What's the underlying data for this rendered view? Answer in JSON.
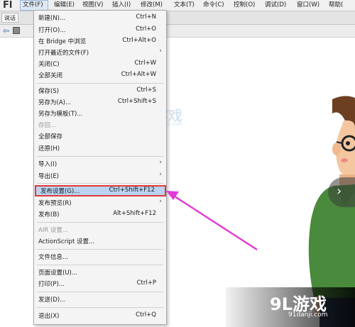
{
  "app": {
    "logo": "Fl"
  },
  "menubar": {
    "items": [
      "文件(F)",
      "编辑(E)",
      "视图(V)",
      "插入(I)",
      "修改(M)",
      "文本(T)",
      "命令(C)",
      "控制(O)",
      "调试(D)",
      "窗口(W)",
      "帮助("
    ]
  },
  "tabbar": {
    "doc_tab": "说话"
  },
  "file_menu": {
    "items": [
      {
        "label": "新建(N)...",
        "shortcut": "Ctrl+N"
      },
      {
        "label": "打开(O)...",
        "shortcut": "Ctrl+O"
      },
      {
        "label": "在 Bridge 中浏览",
        "shortcut": "Ctrl+Alt+O"
      },
      {
        "label": "打开最近的文件(F)",
        "shortcut": ""
      },
      {
        "label": "关闭(C)",
        "shortcut": "Ctrl+W"
      },
      {
        "label": "全部关闭",
        "shortcut": "Ctrl+Alt+W"
      },
      {
        "label": "保存(S)",
        "shortcut": "Ctrl+S"
      },
      {
        "label": "另存为(A)...",
        "shortcut": "Ctrl+Shift+S"
      },
      {
        "label": "另存为模板(T)...",
        "shortcut": ""
      },
      {
        "label": "存回...",
        "shortcut": ""
      },
      {
        "label": "全部保存",
        "shortcut": ""
      },
      {
        "label": "还原(H)",
        "shortcut": ""
      },
      {
        "label": "导入(I)",
        "shortcut": ""
      },
      {
        "label": "导出(E)",
        "shortcut": ""
      },
      {
        "label": "发布设置(G)...",
        "shortcut": "Ctrl+Shift+F12"
      },
      {
        "label": "发布预览(R)",
        "shortcut": ""
      },
      {
        "label": "发布(B)",
        "shortcut": "Alt+Shift+F12"
      },
      {
        "label": "AIR 设置...",
        "shortcut": ""
      },
      {
        "label": "ActionScript 设置...",
        "shortcut": ""
      },
      {
        "label": "文件信息...",
        "shortcut": ""
      },
      {
        "label": "页面设置(U)...",
        "shortcut": ""
      },
      {
        "label": "打印(P)...",
        "shortcut": "Ctrl+P"
      },
      {
        "label": "发送(D)...",
        "shortcut": ""
      },
      {
        "label": "退出(X)",
        "shortcut": "Ctrl+Q"
      }
    ],
    "submenu_arrow": "›"
  },
  "watermark": {
    "brand": "9L游戏",
    "domain": "91danji.com"
  },
  "nav": {
    "chevron": "›"
  },
  "colors": {
    "highlight_fill": "#b9d3f0",
    "highlight_border": "#e03a3a",
    "pointer_arrow": "#e23ad6"
  },
  "icons": [
    "back-arrow-icon",
    "scene-icon",
    "submenu-arrow-icon",
    "chevron-right-icon"
  ]
}
